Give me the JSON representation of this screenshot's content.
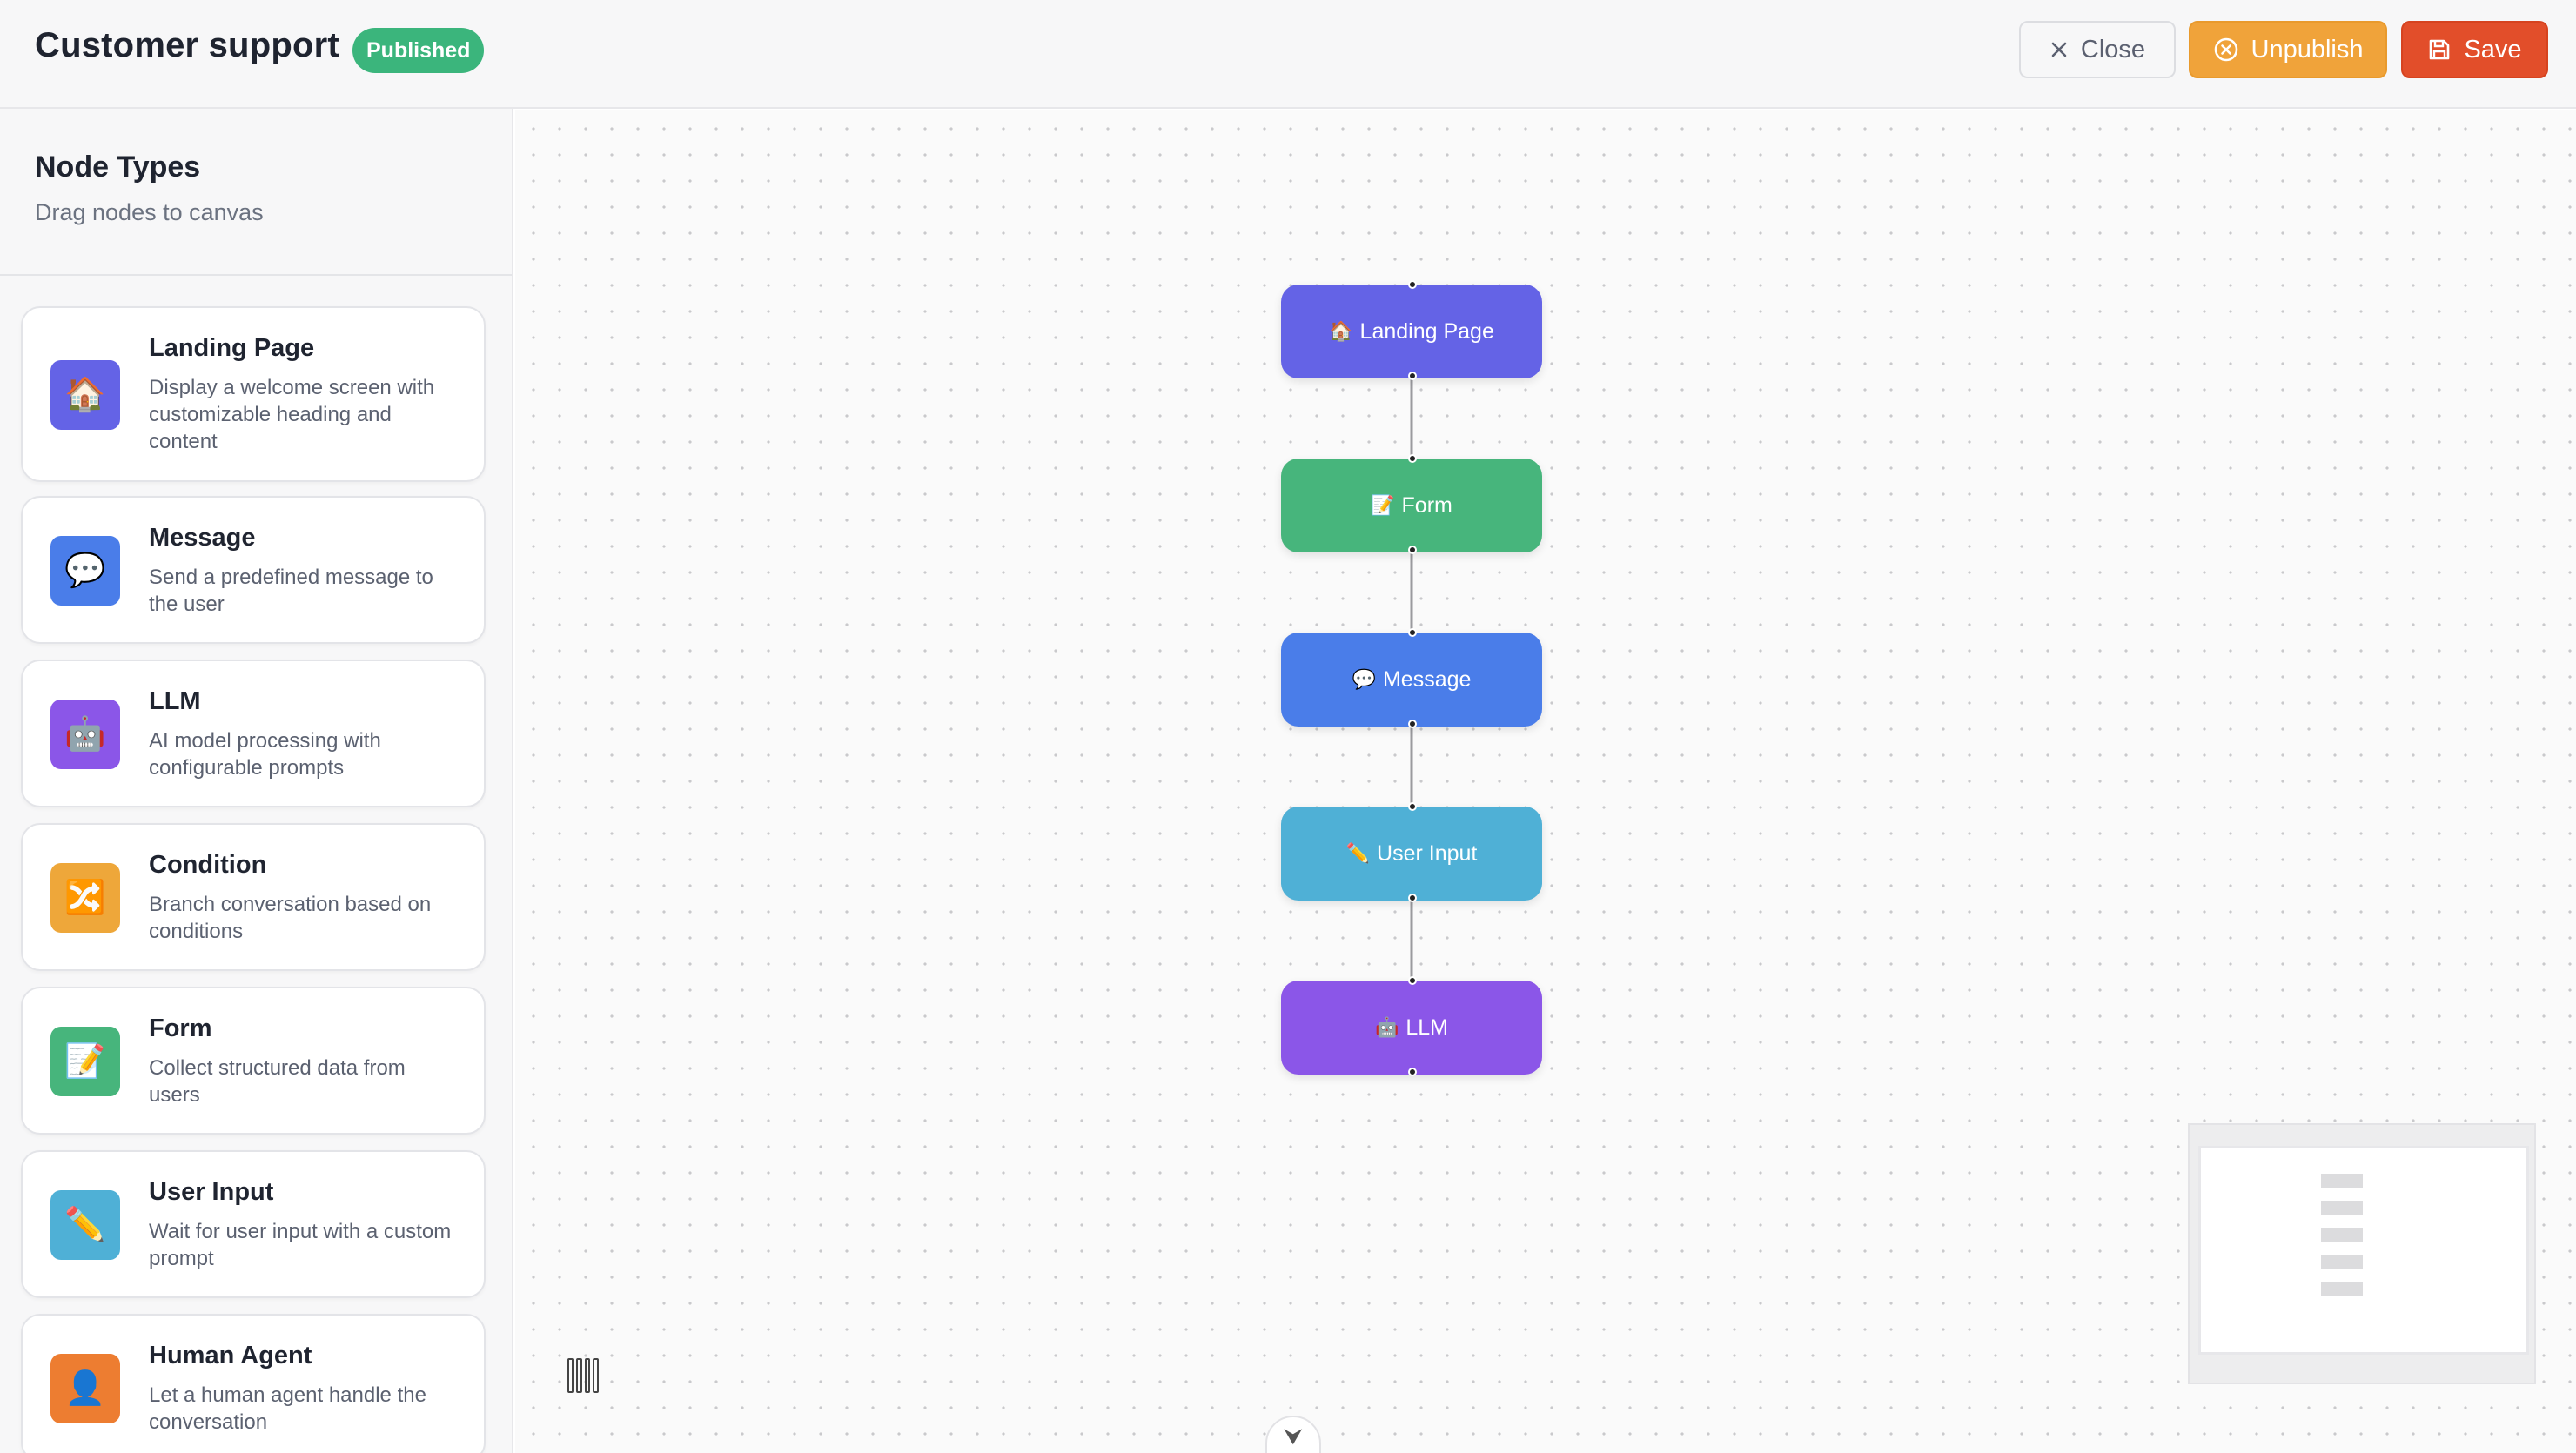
{
  "header": {
    "title": "Customer support",
    "status_badge": "Published",
    "close_label": "Close",
    "unpublish_label": "Unpublish",
    "save_label": "Save"
  },
  "sidebar": {
    "title": "Node Types",
    "subtitle": "Drag nodes to canvas",
    "items": [
      {
        "label": "Landing Page",
        "description": "Display a welcome screen with customizable heading and content",
        "icon": "🏠",
        "icon_name": "house-icon",
        "color": "#6463e6"
      },
      {
        "label": "Message",
        "description": "Send a predefined message to the user",
        "icon": "💬",
        "icon_name": "speech-bubble-icon",
        "color": "#4a7de9"
      },
      {
        "label": "LLM",
        "description": "AI model processing with configurable prompts",
        "icon": "🤖",
        "icon_name": "robot-icon",
        "color": "#8b56e8"
      },
      {
        "label": "Condition",
        "description": "Branch conversation based on conditions",
        "icon": "🔀",
        "icon_name": "shuffle-icon",
        "color": "#eea73a"
      },
      {
        "label": "Form",
        "description": "Collect structured data from users",
        "icon": "📝",
        "icon_name": "memo-icon",
        "color": "#47b57c"
      },
      {
        "label": "User Input",
        "description": "Wait for user input with a custom prompt",
        "icon": "✏️",
        "icon_name": "pencil-icon",
        "color": "#4fb0d6"
      },
      {
        "label": "Human Agent",
        "description": "Let a human agent handle the conversation",
        "icon": "👤",
        "icon_name": "person-icon",
        "color": "#ed7d31"
      }
    ]
  },
  "canvas": {
    "nodes": [
      {
        "label": "Landing Page",
        "icon": "🏠",
        "icon_name": "house-icon",
        "color": "#6463e6"
      },
      {
        "label": "Form",
        "icon": "📝",
        "icon_name": "memo-icon",
        "color": "#47b57c"
      },
      {
        "label": "Message",
        "icon": "💬",
        "icon_name": "speech-bubble-icon",
        "color": "#4a7de9"
      },
      {
        "label": "User Input",
        "icon": "✏️",
        "icon_name": "pencil-icon",
        "color": "#4fb0d6"
      },
      {
        "label": "LLM",
        "icon": "🤖",
        "icon_name": "robot-icon",
        "color": "#8b56e8"
      }
    ],
    "collapse_icon": "⮟"
  }
}
